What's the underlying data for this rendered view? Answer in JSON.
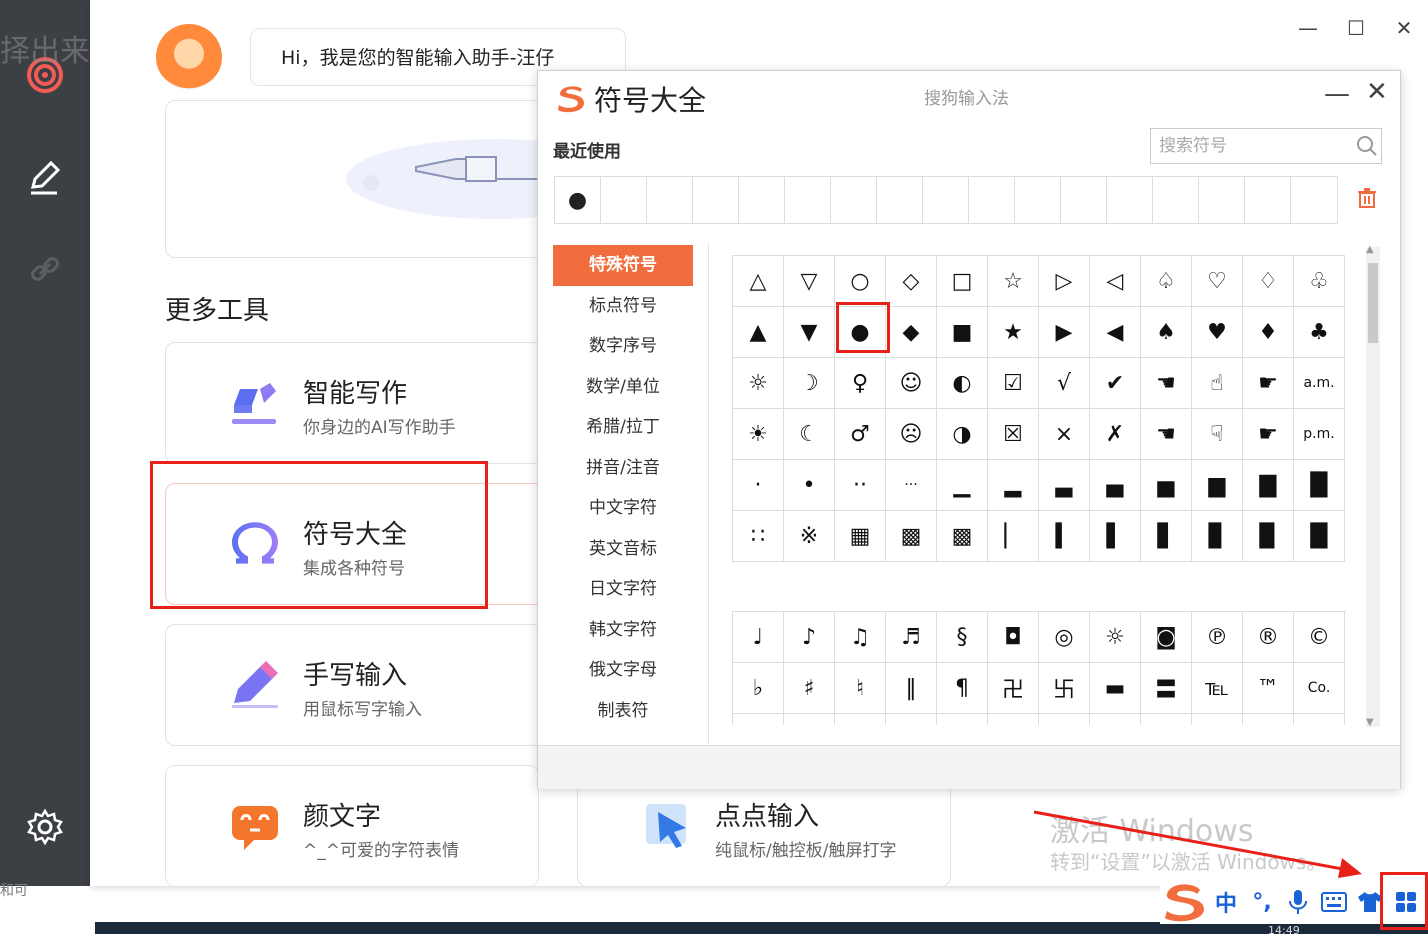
{
  "background": {
    "ghost_text_top": "择出来",
    "ghost_text_bottom": "和可"
  },
  "window_controls": {
    "minimize": "—",
    "maximize": "☐",
    "close": "✕"
  },
  "assistant": {
    "greeting": "Hi，我是您的智能输入助手-汪仔"
  },
  "more_tools": {
    "title": "更多工具",
    "items": [
      {
        "title": "智能写作",
        "subtitle": "你身边的AI写作助手",
        "icon": "pen-write-icon"
      },
      {
        "title": "符号大全",
        "subtitle": "集成各种符号",
        "icon": "omega-icon"
      },
      {
        "title": "手写输入",
        "subtitle": "用鼠标写字输入",
        "icon": "handwrite-pen-icon"
      },
      {
        "title": "颜文字",
        "subtitle": "^_^可爱的字符表情",
        "icon": "kaomoji-icon"
      },
      {
        "title": "点点输入",
        "subtitle": "纯鼠标/触控板/触屏打字",
        "icon": "pointer-click-icon"
      }
    ]
  },
  "symbol_dialog": {
    "title": "符号大全",
    "brand": "搜狗输入法",
    "minimize": "—",
    "close": "✕",
    "recent_label": "最近使用",
    "search_placeholder": "搜索符号",
    "recent": [
      "●",
      "",
      "",
      "",
      "",
      "",
      "",
      "",
      "",
      "",
      "",
      "",
      "",
      "",
      "",
      "",
      ""
    ],
    "categories": [
      "特殊符号",
      "标点符号",
      "数字序号",
      "数学/单位",
      "希腊/拉丁",
      "拼音/注音",
      "中文字符",
      "英文音标",
      "日文字符",
      "韩文字符",
      "俄文字母",
      "制表符"
    ],
    "active_category": 0,
    "grid1": [
      "△",
      "▽",
      "○",
      "◇",
      "□",
      "☆",
      "▷",
      "◁",
      "♤",
      "♡",
      "♢",
      "♧",
      "▲",
      "▼",
      "●",
      "◆",
      "■",
      "★",
      "▶",
      "◀",
      "♠",
      "♥",
      "♦",
      "♣",
      "☼",
      "☽",
      "♀",
      "☺",
      "◐",
      "☑",
      "√",
      "✔",
      "☚",
      "☝",
      "☛",
      "a.m.",
      "☀",
      "☾",
      "♂",
      "☹",
      "◑",
      "☒",
      "×",
      "✗",
      "☚",
      "☟",
      "☛",
      "p.m.",
      "·",
      "•",
      "··",
      "···",
      "▁",
      "▂",
      "▃",
      "▄",
      "▅",
      "▆",
      "▇",
      "█",
      "∷",
      "※",
      "▦",
      "▩",
      "▩",
      "▏",
      "▍",
      "▌",
      "▋",
      "▊",
      "▉",
      "█"
    ],
    "grid2": [
      "♩",
      "♪",
      "♫",
      "♬",
      "§",
      "◘",
      "◎",
      "☼",
      "◙",
      "℗",
      "®",
      "©",
      "♭",
      "♯",
      "♮",
      "‖",
      "¶",
      "卍",
      "卐",
      "▬",
      "〓",
      "℡",
      "™",
      "Co.",
      "",
      "",
      "",
      "",
      "",
      "",
      "",
      "",
      "",
      "",
      "",
      ""
    ]
  },
  "watermark": {
    "line1": "激活 Windows",
    "line2": "转到“设置”以激活 Windows。"
  },
  "ime_toolbar": {
    "items": [
      "中",
      "°,",
      "🎤",
      "⌨",
      "👕",
      "▦"
    ]
  },
  "taskbar": {
    "time": "14:49"
  }
}
